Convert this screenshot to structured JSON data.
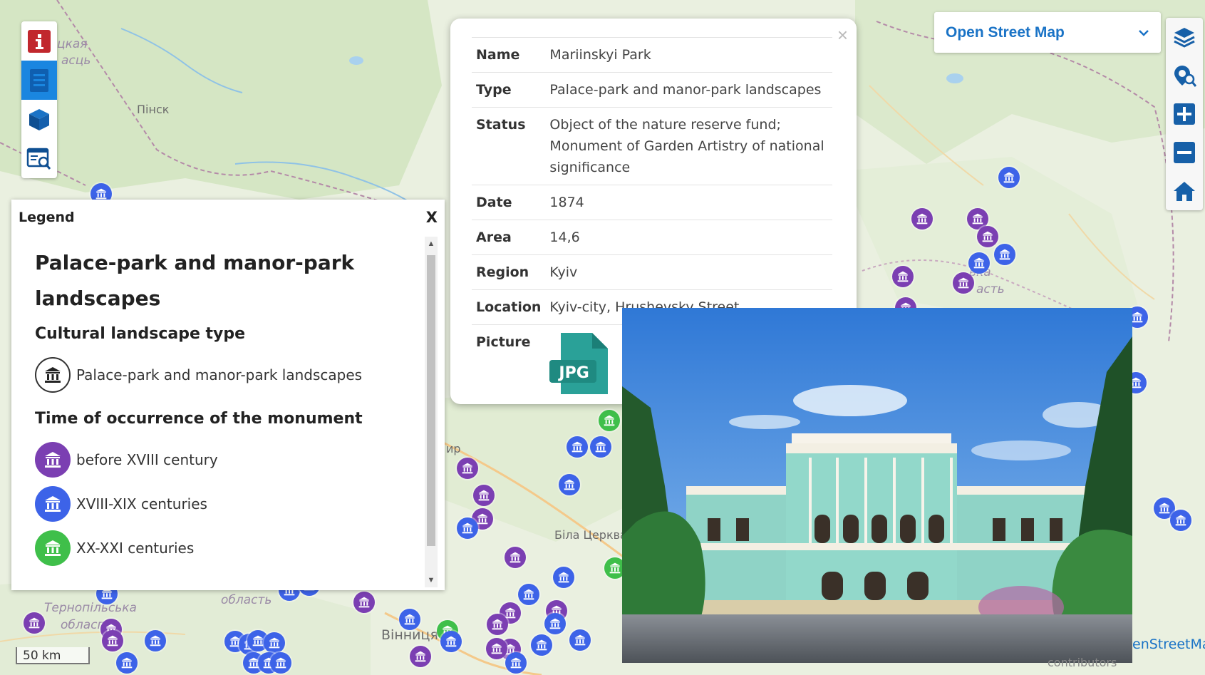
{
  "colors": {
    "purple": "#7b3fb2",
    "blue": "#3d63e8",
    "green": "#3fbf4a",
    "accent": "#1a86e0"
  },
  "toolbar_left": [
    {
      "icon": "info-icon"
    },
    {
      "icon": "document-list-icon"
    },
    {
      "icon": "cube-icon"
    },
    {
      "icon": "search-document-icon"
    }
  ],
  "toolbar_right": [
    {
      "icon": "layers-icon"
    },
    {
      "icon": "locate-search-icon"
    },
    {
      "icon": "zoom-in-icon"
    },
    {
      "icon": "zoom-out-icon"
    },
    {
      "icon": "home-icon"
    }
  ],
  "basemap": {
    "selected": "Open Street Map"
  },
  "map_labels": [
    "цкая",
    "асць",
    "Пінск",
    "ька",
    "асть",
    "Біла Церква",
    "Вінниця",
    "Тернопільська",
    "обласп",
    "область",
    "ир"
  ],
  "legend": {
    "header": "Legend",
    "close": "X",
    "main_title": "Palace-park and manor-park landscapes",
    "section_type": "Cultural landscape type",
    "type_items": [
      {
        "label": "Palace-park and manor-park landscapes",
        "icon": "museum-icon"
      }
    ],
    "section_time": "Time of occurrence of the monument",
    "time_items": [
      {
        "label": "before XVIII century",
        "color": "#7b3fb2"
      },
      {
        "label": "XVIII-XIX centuries",
        "color": "#3d63e8"
      },
      {
        "label": "XX-XXI centuries",
        "color": "#3fbf4a"
      }
    ]
  },
  "popup": {
    "close": "×",
    "rows": [
      {
        "key": "Name",
        "value": "Mariinskyi Park"
      },
      {
        "key": "Type",
        "value": "Palace-park and manor-park landscapes"
      },
      {
        "key": "Status",
        "value": "Object of the nature reserve fund; Monument of Garden Artistry of national significance"
      },
      {
        "key": "Date",
        "value": "1874"
      },
      {
        "key": "Area",
        "value": "14,6"
      },
      {
        "key": "Region",
        "value": "Kyiv"
      },
      {
        "key": "Location",
        "value": "Kyiv-city, Hrushevsky Street"
      }
    ],
    "picture_key": "Picture",
    "picture_badge": "JPG"
  },
  "scale": "50 km",
  "attribution": "enStreetMap",
  "attribution2": "contributors"
}
